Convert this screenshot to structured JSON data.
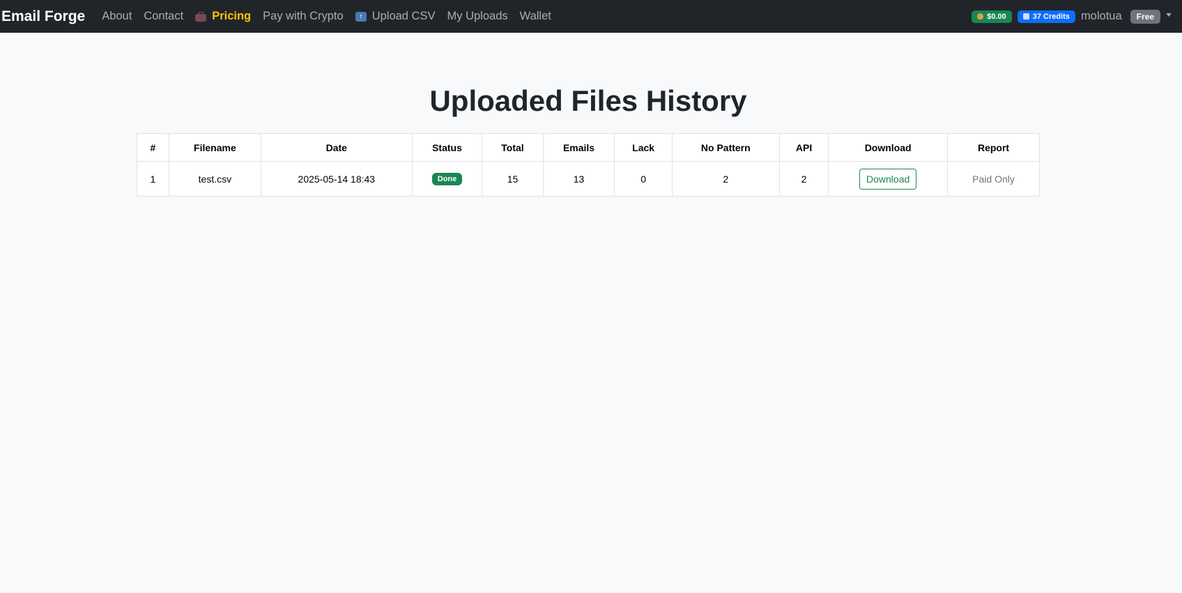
{
  "navbar": {
    "brand": "Email Forge",
    "links": {
      "about": "About",
      "contact": "Contact",
      "pricing": "Pricing",
      "pay_crypto": "Pay with Crypto",
      "upload_csv": "Upload CSV",
      "my_uploads": "My Uploads",
      "wallet": "Wallet"
    },
    "balance": "$0.00",
    "credits": "37 Credits",
    "username": "molotua",
    "plan": "Free"
  },
  "page": {
    "title": "Uploaded Files History"
  },
  "table": {
    "headers": [
      "#",
      "Filename",
      "Date",
      "Status",
      "Total",
      "Emails",
      "Lack",
      "No Pattern",
      "API",
      "Download",
      "Report"
    ],
    "rows": [
      {
        "index": "1",
        "filename": "test.csv",
        "date": "2025-05-14 18:43",
        "status": "Done",
        "total": "15",
        "emails": "13",
        "lack": "0",
        "no_pattern": "2",
        "api": "2",
        "download": "Download",
        "report": "Paid Only"
      }
    ]
  },
  "colors": {
    "navbar_bg": "#212529",
    "pricing": "#ffc107",
    "success": "#198754",
    "primary": "#0d6efd",
    "secondary": "#6c757d"
  }
}
